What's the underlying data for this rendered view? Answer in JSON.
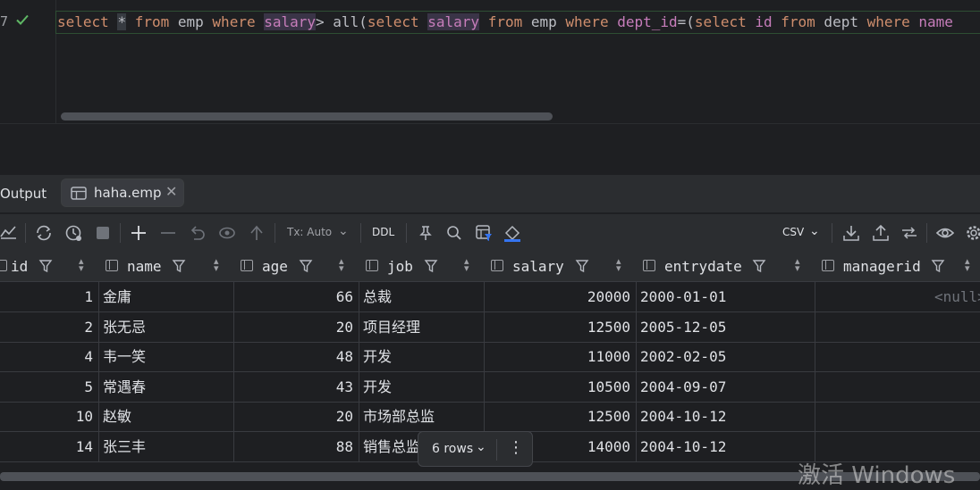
{
  "editor": {
    "line_number": "7",
    "code": {
      "t1": "select",
      "t2": " ",
      "t3": "*",
      "t4": " ",
      "t5": "from",
      "t6": " emp ",
      "t7": "where",
      "t8": " ",
      "t9": "salary",
      "t10": "> all(",
      "t11": "select",
      "t12": " ",
      "t13": "salary",
      "t14": " ",
      "t15": "from",
      "t16": " emp ",
      "t17": "where",
      "t18": " ",
      "t19": "dept_id",
      "t20": "=(",
      "t21": "select",
      "t22": " ",
      "t23": "id",
      "t24": " ",
      "t25": "from",
      "t26": " dept ",
      "t27": "where",
      "t28": " ",
      "t29": "name"
    }
  },
  "tabs": {
    "output": "Output",
    "result": "haha.emp"
  },
  "toolbar": {
    "tx_mode": "Tx: Auto",
    "ddl": "DDL",
    "export_format": "CSV"
  },
  "grid": {
    "columns": [
      "id",
      "name",
      "age",
      "job",
      "salary",
      "entrydate",
      "managerid"
    ],
    "rows": [
      {
        "id": "1",
        "name": "金庸",
        "age": "66",
        "job": "总裁",
        "salary": "20000",
        "entrydate": "2000-01-01",
        "managerid": "<null>"
      },
      {
        "id": "2",
        "name": "张无忌",
        "age": "20",
        "job": "项目经理",
        "salary": "12500",
        "entrydate": "2005-12-05",
        "managerid": ""
      },
      {
        "id": "4",
        "name": "韦一笑",
        "age": "48",
        "job": "开发",
        "salary": "11000",
        "entrydate": "2002-02-05",
        "managerid": ""
      },
      {
        "id": "5",
        "name": "常遇春",
        "age": "43",
        "job": "开发",
        "salary": "10500",
        "entrydate": "2004-09-07",
        "managerid": ""
      },
      {
        "id": "10",
        "name": "赵敏",
        "age": "20",
        "job": "市场部总监",
        "salary": "12500",
        "entrydate": "2004-10-12",
        "managerid": ""
      },
      {
        "id": "14",
        "name": "张三丰",
        "age": "88",
        "job": "销售总监",
        "salary": "14000",
        "entrydate": "2004-10-12",
        "managerid": ""
      }
    ]
  },
  "rows_popup": {
    "count_label": "6 rows",
    "more": "⋮"
  },
  "watermark": "激活 Windows",
  "colors": {
    "keyword": "#cf8e6d",
    "field": "#c77dbb",
    "success": "#5fb865"
  }
}
